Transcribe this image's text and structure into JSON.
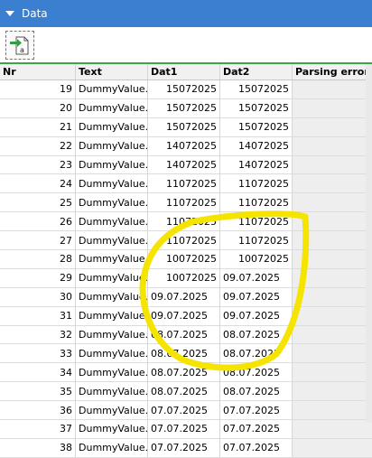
{
  "title": "Data",
  "toolbar": {
    "icon": "export-to-text-icon"
  },
  "columns": [
    "Nr",
    "Text",
    "Dat1",
    "Dat2",
    "Parsing errors"
  ],
  "rows": [
    {
      "nr": "19",
      "text": "DummyValue...",
      "d1": "15072025",
      "d2": "15072025",
      "a1": "right",
      "a2": "right"
    },
    {
      "nr": "20",
      "text": "DummyValue...",
      "d1": "15072025",
      "d2": "15072025",
      "a1": "right",
      "a2": "right"
    },
    {
      "nr": "21",
      "text": "DummyValue...",
      "d1": "15072025",
      "d2": "15072025",
      "a1": "right",
      "a2": "right"
    },
    {
      "nr": "22",
      "text": "DummyValue...",
      "d1": "14072025",
      "d2": "14072025",
      "a1": "right",
      "a2": "right"
    },
    {
      "nr": "23",
      "text": "DummyValue...",
      "d1": "14072025",
      "d2": "14072025",
      "a1": "right",
      "a2": "right"
    },
    {
      "nr": "24",
      "text": "DummyValue...",
      "d1": "11072025",
      "d2": "11072025",
      "a1": "right",
      "a2": "right"
    },
    {
      "nr": "25",
      "text": "DummyValue...",
      "d1": "11072025",
      "d2": "11072025",
      "a1": "right",
      "a2": "right"
    },
    {
      "nr": "26",
      "text": "DummyValue...",
      "d1": "11072025",
      "d2": "11072025",
      "a1": "right",
      "a2": "right"
    },
    {
      "nr": "27",
      "text": "DummyValue...",
      "d1": "11072025",
      "d2": "11072025",
      "a1": "right",
      "a2": "right"
    },
    {
      "nr": "28",
      "text": "DummyValue...",
      "d1": "10072025",
      "d2": "10072025",
      "a1": "right",
      "a2": "right"
    },
    {
      "nr": "29",
      "text": "DummyValue...",
      "d1": "10072025",
      "d2": "09.07.2025",
      "a1": "right",
      "a2": "left"
    },
    {
      "nr": "30",
      "text": "DummyValue...",
      "d1": "09.07.2025",
      "d2": "09.07.2025",
      "a1": "left",
      "a2": "left"
    },
    {
      "nr": "31",
      "text": "DummyValue...",
      "d1": "09.07.2025",
      "d2": "09.07.2025",
      "a1": "left",
      "a2": "left"
    },
    {
      "nr": "32",
      "text": "DummyValue...",
      "d1": "08.07.2025",
      "d2": "08.07.2025",
      "a1": "left",
      "a2": "left"
    },
    {
      "nr": "33",
      "text": "DummyValue...",
      "d1": "08.07.2025",
      "d2": "08.07.2025",
      "a1": "left",
      "a2": "left"
    },
    {
      "nr": "34",
      "text": "DummyValue...",
      "d1": "08.07.2025",
      "d2": "08.07.2025",
      "a1": "left",
      "a2": "left"
    },
    {
      "nr": "35",
      "text": "DummyValue...",
      "d1": "08.07.2025",
      "d2": "08.07.2025",
      "a1": "left",
      "a2": "left"
    },
    {
      "nr": "36",
      "text": "DummyValue...",
      "d1": "07.07.2025",
      "d2": "07.07.2025",
      "a1": "left",
      "a2": "left"
    },
    {
      "nr": "37",
      "text": "DummyValue...",
      "d1": "07.07.2025",
      "d2": "07.07.2025",
      "a1": "left",
      "a2": "left"
    },
    {
      "nr": "38",
      "text": "DummyValue...",
      "d1": "07.07.2025",
      "d2": "07.07.2025",
      "a1": "left",
      "a2": "left"
    }
  ],
  "colors": {
    "title_bar": "#3a7fd0",
    "accent_line": "#36a64f",
    "annotation": "#f5e400"
  }
}
